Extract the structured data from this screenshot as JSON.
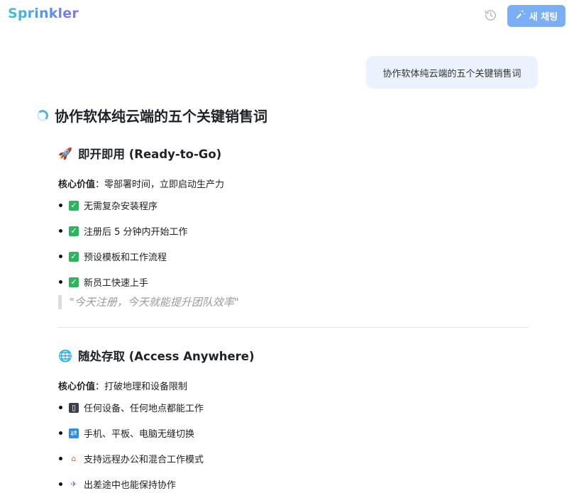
{
  "header": {
    "app_name": "Sprinkler",
    "new_chat_label": "새 채팅",
    "history_icon": "history-icon",
    "new_chat_icon": "magic-wand-icon"
  },
  "user_message": "协作软体纯云端的五个关键销售词",
  "answer": {
    "title": "协作软体纯云端的五个关键销售词",
    "status_icon": "loading-spinner-icon",
    "sections": [
      {
        "icon": "🚀",
        "heading": "即开即用 (Ready-to-Go)",
        "core_label": "核心价值",
        "core_value": "：零部署时间，立即启动生产力",
        "bullets": [
          {
            "icon": "✓",
            "text": "无需复杂安装程序"
          },
          {
            "icon": "✓",
            "text": "注册后 5 分钟内开始工作"
          },
          {
            "icon": "✓",
            "text": "预设模板和工作流程"
          },
          {
            "icon": "✓",
            "text": "新员工快速上手"
          }
        ],
        "quote": "\"今天注册，今天就能提升团队效率\""
      },
      {
        "icon": "🌐",
        "heading": "随处存取 (Access Anywhere)",
        "core_label": "核心价值",
        "core_value": "：打破地理和设备限制",
        "bullets": [
          {
            "icon": "▯",
            "text": "任何设备、任何地点都能工作"
          },
          {
            "icon": "⇄",
            "text": "手机、平板、电脑无缝切换"
          },
          {
            "icon": "⌂",
            "text": "支持远程办公和混合工作模式"
          },
          {
            "icon": "✈",
            "text": "出差途中也能保持协作"
          }
        ]
      }
    ]
  },
  "colors": {
    "accent": "#7aaef5",
    "user_bubble": "#eaf3fd",
    "check": "#2db55d"
  }
}
